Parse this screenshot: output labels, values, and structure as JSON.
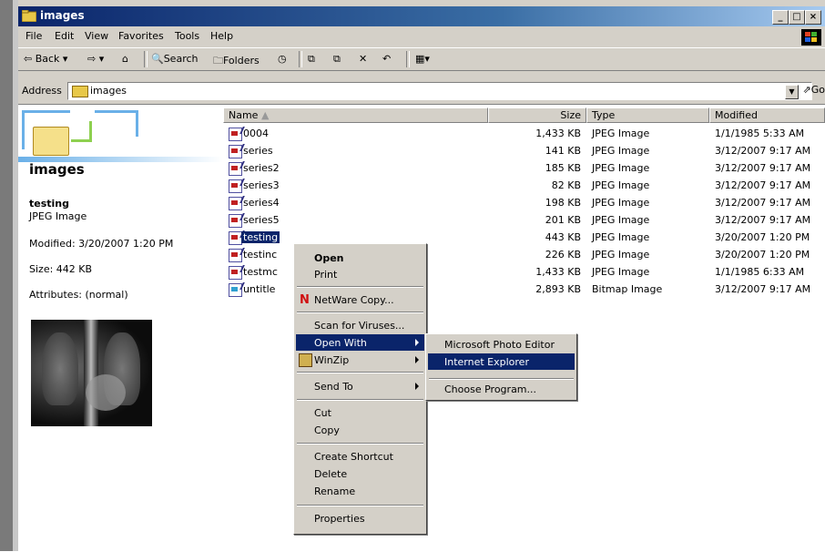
{
  "window": {
    "title": "images"
  },
  "menu": [
    "File",
    "Edit",
    "View",
    "Favorites",
    "Tools",
    "Help"
  ],
  "toolbar": {
    "back": "Back",
    "search": "Search",
    "folders": "Folders"
  },
  "address": {
    "label": "Address",
    "value": "images",
    "go": "Go"
  },
  "left_panel": {
    "folder_title": "images",
    "selected_name": "testing",
    "selected_type": "JPEG Image",
    "modified": "Modified: 3/20/2007 1:20 PM",
    "size": "Size: 442 KB",
    "attributes": "Attributes: (normal)"
  },
  "columns": {
    "name": "Name",
    "size": "Size",
    "type": "Type",
    "modified": "Modified"
  },
  "files": [
    {
      "name": "0004",
      "size": "1,433 KB",
      "type": "JPEG Image",
      "modified": "1/1/1985 5:33 AM"
    },
    {
      "name": "series",
      "size": "141 KB",
      "type": "JPEG Image",
      "modified": "3/12/2007 9:17 AM"
    },
    {
      "name": "series2",
      "size": "185 KB",
      "type": "JPEG Image",
      "modified": "3/12/2007 9:17 AM"
    },
    {
      "name": "series3",
      "size": "82 KB",
      "type": "JPEG Image",
      "modified": "3/12/2007 9:17 AM"
    },
    {
      "name": "series4",
      "size": "198 KB",
      "type": "JPEG Image",
      "modified": "3/12/2007 9:17 AM"
    },
    {
      "name": "series5",
      "size": "201 KB",
      "type": "JPEG Image",
      "modified": "3/12/2007 9:17 AM"
    },
    {
      "name": "testing",
      "size": "443 KB",
      "type": "JPEG Image",
      "modified": "3/20/2007 1:20 PM"
    },
    {
      "name": "testinc",
      "size": "226 KB",
      "type": "JPEG Image",
      "modified": "3/20/2007 1:20 PM"
    },
    {
      "name": "testmc",
      "size": "1,433 KB",
      "type": "JPEG Image",
      "modified": "1/1/1985 6:33 AM"
    },
    {
      "name": "untitle",
      "size": "2,893 KB",
      "type": "Bitmap Image",
      "modified": "3/12/2007 9:17 AM"
    }
  ],
  "context_menu": {
    "open": "Open",
    "print": "Print",
    "netware": "NetWare Copy...",
    "scan": "Scan for Viruses...",
    "open_with": "Open With",
    "winzip": "WinZip",
    "send_to": "Send To",
    "cut": "Cut",
    "copy": "Copy",
    "create_shortcut": "Create Shortcut",
    "delete": "Delete",
    "rename": "Rename",
    "properties": "Properties"
  },
  "submenu": {
    "photo_editor": "Microsoft Photo Editor",
    "ie": "Internet Explorer",
    "choose": "Choose Program..."
  },
  "colors": {
    "titlebar": "#0a246a",
    "highlight": "#0a246a",
    "face": "#d4d0c8"
  }
}
